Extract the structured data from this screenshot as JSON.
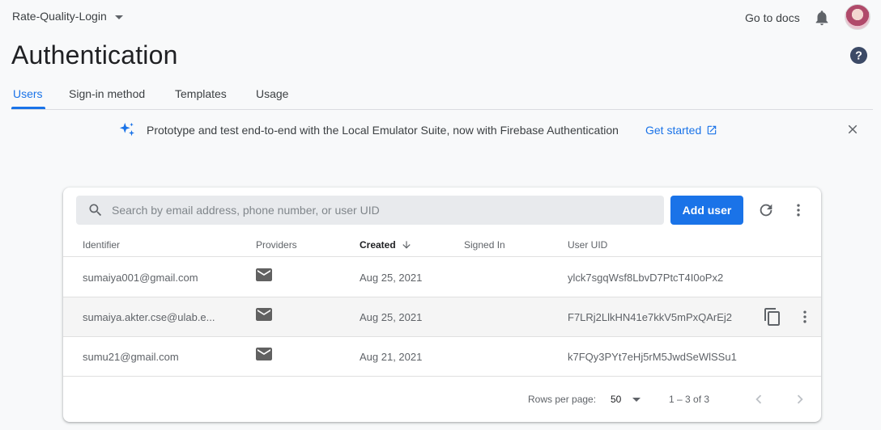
{
  "header": {
    "project_name": "Rate-Quality-Login",
    "docs_label": "Go to docs"
  },
  "page": {
    "title": "Authentication"
  },
  "tabs": [
    {
      "label": "Users"
    },
    {
      "label": "Sign-in method"
    },
    {
      "label": "Templates"
    },
    {
      "label": "Usage"
    }
  ],
  "banner": {
    "text": "Prototype and test end-to-end with the Local Emulator Suite, now with Firebase Authentication",
    "link_label": "Get started"
  },
  "toolbar": {
    "search_placeholder": "Search by email address, phone number, or user UID",
    "add_user_label": "Add user"
  },
  "table": {
    "columns": [
      "Identifier",
      "Providers",
      "Created",
      "Signed In",
      "User UID"
    ],
    "rows": [
      {
        "identifier": "sumaiya001@gmail.com",
        "provider": "email-icon",
        "created": "Aug 25, 2021",
        "signed_in": "",
        "uid": "ylck7sgqWsf8LbvD7PtcT4I0oPx2"
      },
      {
        "identifier": "sumaiya.akter.cse@ulab.e...",
        "provider": "email-icon",
        "created": "Aug 25, 2021",
        "signed_in": "",
        "uid": "F7LRj2LlkHN41e7kkV5mPxQArEj2"
      },
      {
        "identifier": "sumu21@gmail.com",
        "provider": "email-icon",
        "created": "Aug 21, 2021",
        "signed_in": "",
        "uid": "k7FQy3PYt7eHj5rM5JwdSeWlSSu1"
      }
    ]
  },
  "pagination": {
    "rows_per_page_label": "Rows per page:",
    "rows_per_page_value": "50",
    "range_text": "1 – 3 of 3"
  },
  "colors": {
    "accent": "#1a73e8",
    "icon": "#5f6368"
  }
}
